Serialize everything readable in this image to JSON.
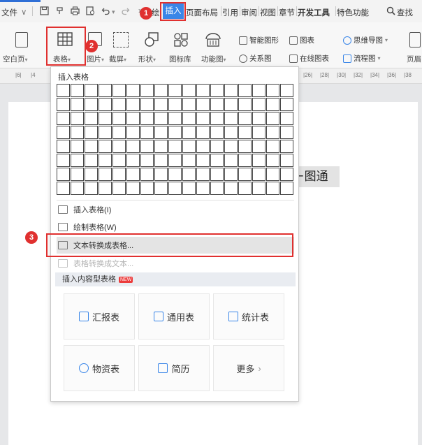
{
  "menu": {
    "file": "文件",
    "file_arrow": "∨",
    "more": "»",
    "tab_before": "绘",
    "active_tab": "插入",
    "tabs": [
      "页面布局",
      "引用",
      "审阅",
      "视图",
      "章节",
      "开发工具",
      "特色功能"
    ],
    "search": "查找"
  },
  "ribbon": {
    "blank_page": "空白页",
    "table": "表格",
    "picture": "图片",
    "screenshot": "截屏",
    "shape": "形状",
    "icon_lib": "图标库",
    "func_chart": "功能图",
    "smart_shape": "智能图形",
    "relation": "关系图",
    "chart": "图表",
    "online_chart": "在线图表",
    "mindmap": "思维导图",
    "flowchart": "流程图",
    "page_end": "页眉"
  },
  "ruler": {
    "left_marks": [
      "|6|",
      "|4"
    ],
    "right_marks": [
      "|26|",
      "|28|",
      "|30|",
      "|32|",
      "|34|",
      "|36|",
      "|38"
    ]
  },
  "dropdown": {
    "title": "插入表格",
    "items": [
      {
        "label": "插入表格(I)",
        "enabled": true
      },
      {
        "label": "绘制表格(W)",
        "enabled": true
      },
      {
        "label": "文本转换成表格...",
        "enabled": true,
        "highlighted": true
      },
      {
        "label": "表格转换成文本...",
        "enabled": false
      }
    ],
    "section": "插入内容型表格",
    "new_badge": "NEW",
    "cards": [
      "汇报表",
      "通用表",
      "统计表",
      "物资表",
      "简历",
      "更多"
    ],
    "more_arrow": "›"
  },
  "page_text": "图通",
  "page_text_prefix": "⊢",
  "steps": [
    "1",
    "2",
    "3"
  ],
  "colors": {
    "accent": "#3a86e8",
    "annotation_red": "#e0302f",
    "highlight": "#e4e4e4"
  }
}
